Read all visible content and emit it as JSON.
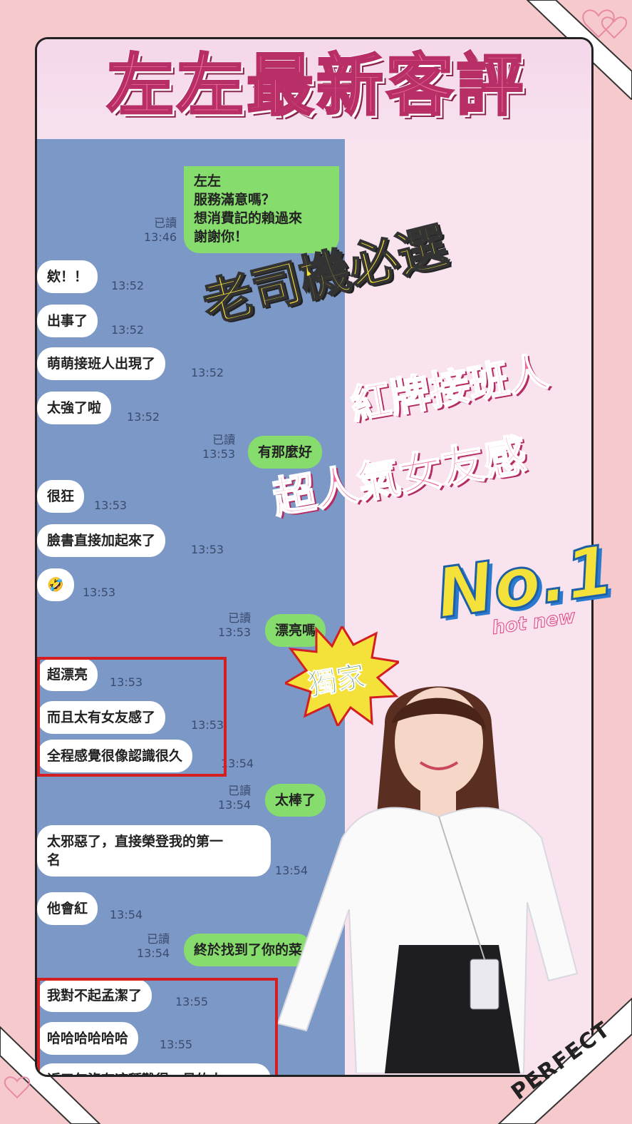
{
  "title": "左左最新客評",
  "chat": [
    {
      "dir": "out",
      "text": "左左\n服務滿意嗎？\n想消費記的賴過來\n謝謝你！",
      "read": "已讀",
      "time": "13:46"
    },
    {
      "dir": "in",
      "text": "欸！！",
      "time": "13:52"
    },
    {
      "dir": "in",
      "text": "出事了",
      "time": "13:52"
    },
    {
      "dir": "in",
      "text": "萌萌接班人出現了",
      "time": "13:52"
    },
    {
      "dir": "in",
      "text": "太強了啦",
      "time": "13:52"
    },
    {
      "dir": "out",
      "text": "有那麼好",
      "read": "已讀",
      "time": "13:53"
    },
    {
      "dir": "in",
      "text": "很狂",
      "time": "13:53"
    },
    {
      "dir": "in",
      "text": "臉書直接加起來了",
      "time": "13:53"
    },
    {
      "dir": "in",
      "text": "🤣",
      "time": "13:53"
    },
    {
      "dir": "out",
      "text": "漂亮嗎",
      "read": "已讀",
      "time": "13:53"
    },
    {
      "dir": "in",
      "text": "超漂亮",
      "time": "13:53"
    },
    {
      "dir": "in",
      "text": "而且太有女友感了",
      "time": "13:53"
    },
    {
      "dir": "in",
      "text": "全程感覺很像認識很久",
      "time": "13:54"
    },
    {
      "dir": "out",
      "text": "太棒了",
      "read": "已讀",
      "time": "13:54"
    },
    {
      "dir": "in",
      "text": "太邪惡了，直接榮登我的第一\n名",
      "time": "13:54"
    },
    {
      "dir": "in",
      "text": "他會紅",
      "time": "13:54"
    },
    {
      "dir": "out",
      "text": "終於找到了你的菜",
      "read": "已讀",
      "time": "13:54"
    },
    {
      "dir": "in",
      "text": "我對不起孟潔了",
      "time": "13:55"
    },
    {
      "dir": "in",
      "text": "哈哈哈哈哈哈",
      "time": "13:55"
    },
    {
      "dir": "in",
      "text": "近五年沒有這種難得一見的人\n才了",
      "time": ""
    }
  ],
  "decor": {
    "slogan1": "老司機必選",
    "slogan2": "紅牌接班人",
    "slogan3": "超人氣女友感",
    "rank": "No.1",
    "hot": "hot new",
    "exclusive": "獨家",
    "perfect": "PERFECT"
  },
  "colors": {
    "background": "#f6c9cc",
    "chat_bg": "#7b98c7",
    "out_bubble": "#86dc6c",
    "highlight_box": "#d31e22"
  }
}
